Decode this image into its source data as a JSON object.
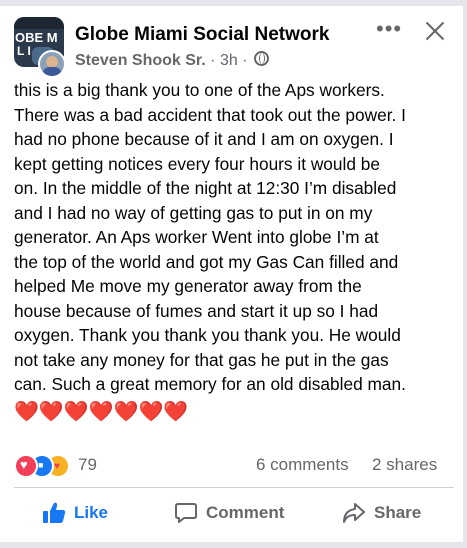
{
  "post": {
    "group_name": "Globe Miami Social Network",
    "author": "Steven Shook Sr.",
    "time": "3h",
    "separator": "·",
    "avatar_text_1": "OBE M",
    "avatar_text_2": "L I",
    "body_lines": [
      "this is a big thank you to one of the Aps workers.",
      "There was a bad accident that took out the power. I",
      "had no phone because of it and I am on oxygen. I",
      "kept getting notices every four hours it would be",
      "on. In the middle of the night at 12:30 I’m disabled",
      "and I had no way of getting gas to put in on my",
      "generator. An Aps worker Went into globe I’m at",
      "the top of the world and got my Gas Can filled and",
      "helped Me move my generator away from the",
      "house because of fumes and start it up so I had",
      "oxygen. Thank you thank you thank you. He would",
      "not take any money for that gas he put in the gas",
      "can. Such a great memory for an old disabled man."
    ],
    "hearts": "❤️❤️❤️❤️❤️❤️❤️"
  },
  "stats": {
    "reaction_count": "79",
    "comments": "6 comments",
    "shares": "2 shares",
    "reaction_icons": [
      "love-icon",
      "like-icon",
      "care-icon"
    ]
  },
  "actions": {
    "like_label": "Like",
    "comment_label": "Comment",
    "share_label": "Share"
  },
  "colors": {
    "accent": "#1877f2",
    "secondary_text": "#65676b",
    "heart": "#e41e3f"
  }
}
